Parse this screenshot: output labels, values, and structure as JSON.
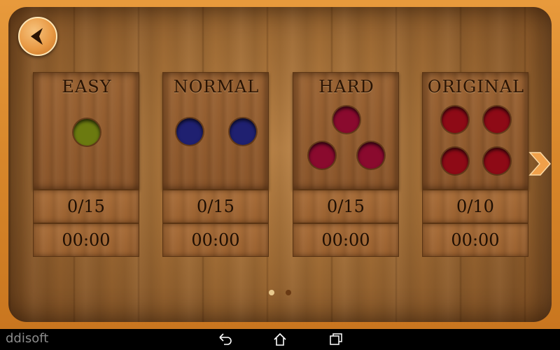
{
  "watermark": "ddisoft",
  "levels": [
    {
      "title": "EASY",
      "score": "0/15",
      "time": "00:00",
      "hole_color": "#6b7a10"
    },
    {
      "title": "NORMAL",
      "score": "0/15",
      "time": "00:00",
      "hole_color": "#1f2070"
    },
    {
      "title": "HARD",
      "score": "0/15",
      "time": "00:00",
      "hole_color": "#8a0a2e"
    },
    {
      "title": "ORIGINAL",
      "score": "0/10",
      "time": "00:00",
      "hole_color": "#8e0a16"
    }
  ],
  "pager": {
    "pages": 2,
    "current": 1
  },
  "icons": {
    "back": "back-arrow-icon",
    "next": "chevron-right-icon",
    "nav_back": "nav-back-icon",
    "nav_home": "nav-home-icon",
    "nav_recents": "nav-recents-icon"
  },
  "colors": {
    "frame": "#d7862a",
    "accent": "#f0a04a",
    "text": "#2a1404"
  }
}
